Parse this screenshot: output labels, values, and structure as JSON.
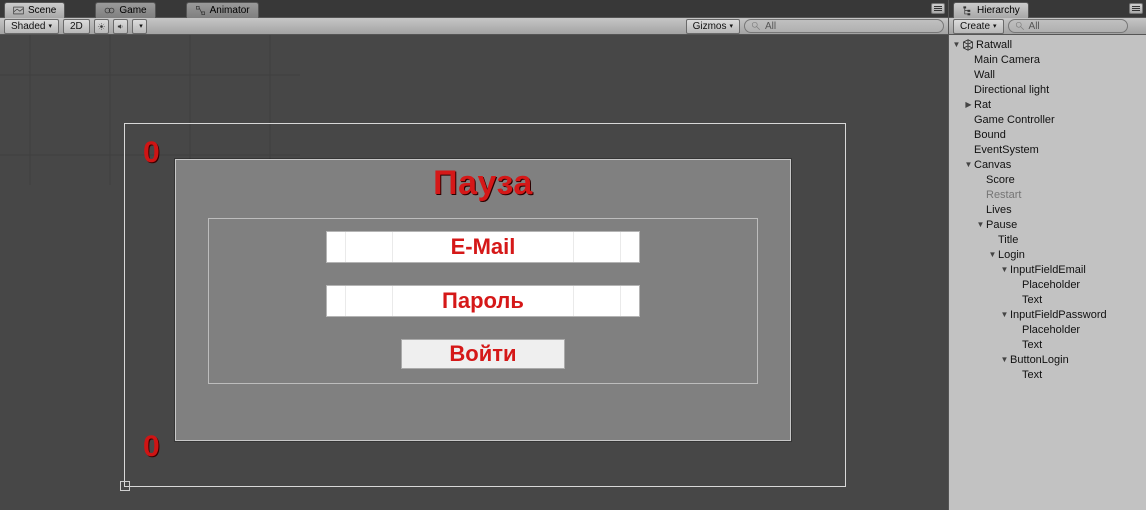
{
  "tabs": {
    "scene": "Scene",
    "game": "Game",
    "animator": "Animator",
    "hierarchy": "Hierarchy"
  },
  "toolbar": {
    "shading": "Shaded",
    "mode2d": "2D",
    "gizmos": "Gizmos",
    "search_placeholder": "All",
    "create": "Create"
  },
  "scene": {
    "score_top": "0",
    "score_bottom": "0",
    "pause_title": "Пауза",
    "email_placeholder": "E-Mail",
    "password_placeholder": "Пароль",
    "login_label": "Войти"
  },
  "hierarchy": [
    {
      "label": "Ratwall",
      "indent": 0,
      "arrow": "down",
      "unity": true
    },
    {
      "label": "Main Camera",
      "indent": 1
    },
    {
      "label": "Wall",
      "indent": 1
    },
    {
      "label": "Directional light",
      "indent": 1
    },
    {
      "label": "Rat",
      "indent": 1,
      "arrow": "right"
    },
    {
      "label": "Game Controller",
      "indent": 1
    },
    {
      "label": "Bound",
      "indent": 1
    },
    {
      "label": "EventSystem",
      "indent": 1
    },
    {
      "label": "Canvas",
      "indent": 1,
      "arrow": "down"
    },
    {
      "label": "Score",
      "indent": 2
    },
    {
      "label": "Restart",
      "indent": 2,
      "dim": true
    },
    {
      "label": "Lives",
      "indent": 2
    },
    {
      "label": "Pause",
      "indent": 2,
      "arrow": "down"
    },
    {
      "label": "Title",
      "indent": 3
    },
    {
      "label": "Login",
      "indent": 3,
      "arrow": "down"
    },
    {
      "label": "InputFieldEmail",
      "indent": 4,
      "arrow": "down"
    },
    {
      "label": "Placeholder",
      "indent": 5
    },
    {
      "label": "Text",
      "indent": 5
    },
    {
      "label": "InputFieldPassword",
      "indent": 4,
      "arrow": "down"
    },
    {
      "label": "Placeholder",
      "indent": 5
    },
    {
      "label": "Text",
      "indent": 5
    },
    {
      "label": "ButtonLogin",
      "indent": 4,
      "arrow": "down"
    },
    {
      "label": "Text",
      "indent": 5
    }
  ],
  "colors": {
    "accent": "#d51818"
  }
}
